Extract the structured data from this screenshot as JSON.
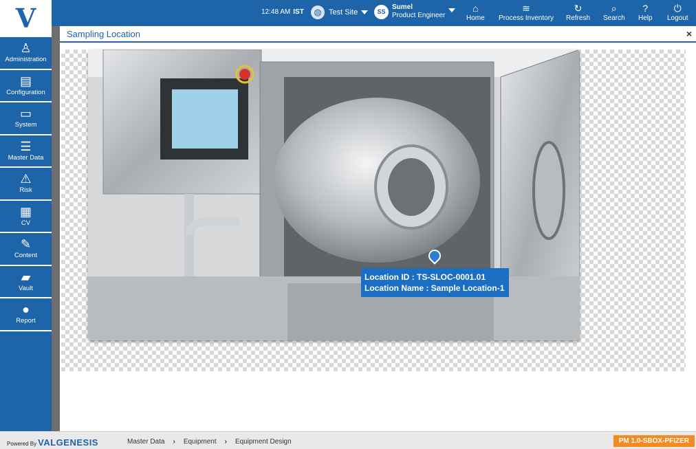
{
  "topbar": {
    "time": "12:48 AM",
    "timezone": "IST",
    "site": "Test Site",
    "user": {
      "initials": "SS",
      "name": "Sumel",
      "role": "Product Engineer"
    },
    "nav": [
      {
        "label": "Home",
        "icon": "home-icon"
      },
      {
        "label": "Process Inventory",
        "icon": "layers-icon"
      },
      {
        "label": "Refresh",
        "icon": "refresh-icon"
      },
      {
        "label": "Search",
        "icon": "search-icon"
      },
      {
        "label": "Help",
        "icon": "help-icon"
      },
      {
        "label": "Logout",
        "icon": "power-icon"
      }
    ]
  },
  "sidebar": {
    "items": [
      {
        "label": "Administration",
        "icon": "admin-icon"
      },
      {
        "label": "Configuration",
        "icon": "config-icon"
      },
      {
        "label": "System",
        "icon": "monitor-icon"
      },
      {
        "label": "Master Data",
        "icon": "database-icon"
      },
      {
        "label": "Risk",
        "icon": "warning-icon"
      },
      {
        "label": "CV",
        "icon": "cv-icon"
      },
      {
        "label": "Content",
        "icon": "edit-icon"
      },
      {
        "label": "Vault",
        "icon": "book-icon"
      },
      {
        "label": "Report",
        "icon": "microphone-icon"
      }
    ]
  },
  "panel": {
    "title": "Sampling Location",
    "close": "×"
  },
  "location": {
    "id_line": "Location ID : TS-SLOC-0001.01",
    "name_line": "Location Name : Sample Location-1"
  },
  "footer": {
    "powered_by": "Powered By",
    "brand": "VALGENESIS",
    "breadcrumb": [
      "Master Data",
      "Equipment",
      "Equipment Design"
    ],
    "environment": "PM 1.0-SBOX-PFIZER"
  },
  "colors": {
    "primary": "#1d64a8",
    "accent": "#f28b21"
  }
}
